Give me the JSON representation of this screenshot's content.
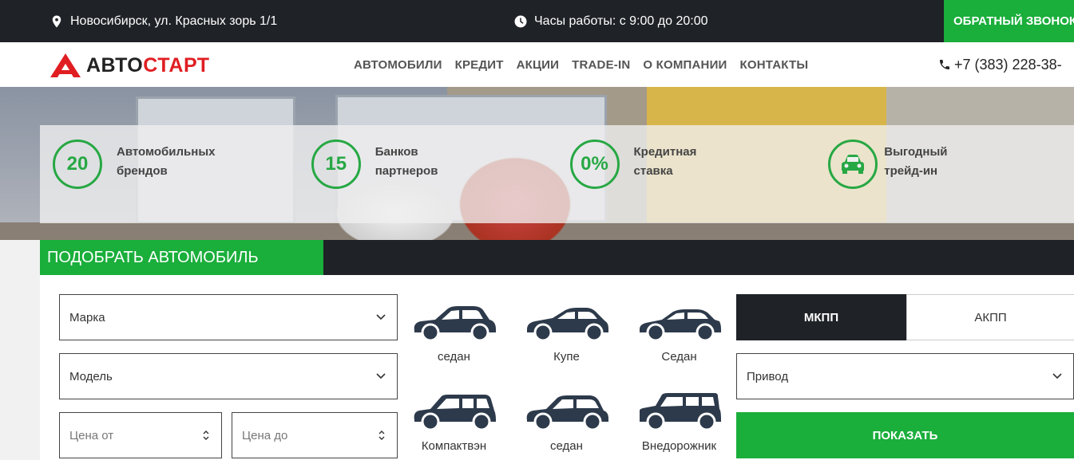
{
  "topbar": {
    "address": "Новосибирск, ул. Красных зорь 1/1",
    "hours": "Часы работы: с 9:00 до 20:00",
    "callback_label": "ОБРАТНЫЙ ЗВОНОК"
  },
  "header": {
    "logo_part1": "АВТО",
    "logo_part2": "СТАРТ",
    "nav": [
      "АВТОМОБИЛИ",
      "КРЕДИТ",
      "АКЦИИ",
      "TRADE-IN",
      "О КОМПАНИИ",
      "КОНТАКТЫ"
    ],
    "phone": "+7 (383) 228-38-"
  },
  "stats": [
    {
      "value": "20",
      "line1": "Автомобильных",
      "line2": "брендов"
    },
    {
      "value": "15",
      "line1": "Банков",
      "line2": "партнеров"
    },
    {
      "value": "0%",
      "line1": "Кредитная",
      "line2": "ставка"
    },
    {
      "icon": "car-icon",
      "line1": "Выгодный",
      "line2": "трейд-ин"
    }
  ],
  "filter": {
    "title": "ПОДОБРАТЬ АВТОМОБИЛЬ",
    "brand_label": "Марка",
    "model_label": "Модель",
    "price_from_placeholder": "Цена от",
    "price_to_placeholder": "Цена до",
    "body_types": [
      "седан",
      "Купе",
      "Седан",
      "Компактвэн",
      "седан",
      "Внедорожник"
    ],
    "transmission": {
      "manual": "МКПП",
      "auto": "АКПП"
    },
    "drive_label": "Привод",
    "show_button": "ПОКАЗАТЬ"
  },
  "colors": {
    "accent": "#1aae3b",
    "dark": "#1f2226",
    "logo_red": "#e01e22",
    "car_icon": "#2d3a4b"
  }
}
